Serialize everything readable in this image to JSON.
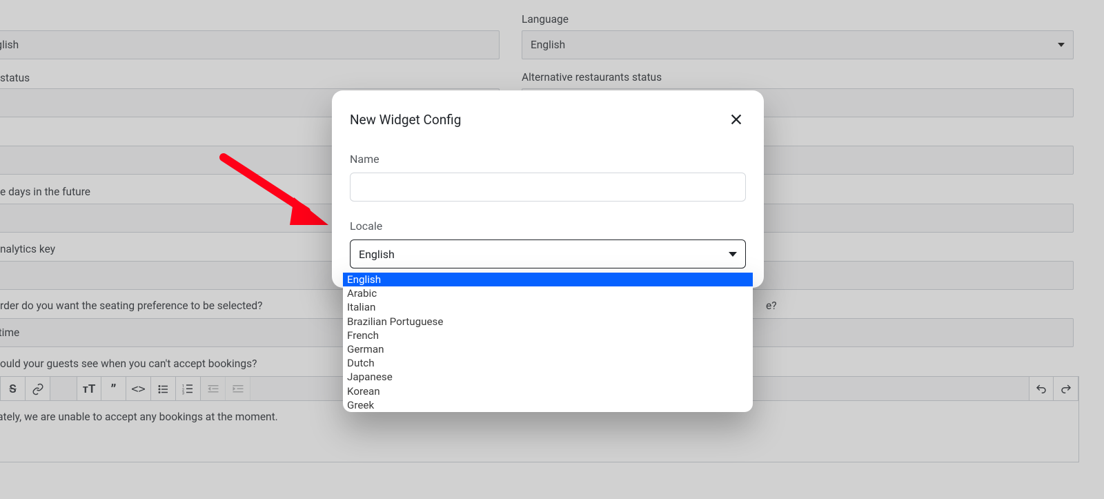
{
  "bg": {
    "left": {
      "english_value": "English",
      "status_label": "status",
      "days_future_label": "e days in the future",
      "analytics_label": "nalytics key",
      "seating_pref_label": "rder do you want the seating preference to be selected?",
      "seating_pref_value": "he time",
      "unavailable_msg_label": "ould your guests see when you can't accept bookings?",
      "unavailable_msg_value": "unately, we are unable to accept any bookings at the moment."
    },
    "right": {
      "language_label": "Language",
      "language_value": "English",
      "alt_status_label": "Alternative restaurants status",
      "seating_type_label_tail": "e?"
    }
  },
  "modal": {
    "title": "New Widget Config",
    "name_label": "Name",
    "name_value": "",
    "locale_label": "Locale",
    "locale_value": "English",
    "locale_options": [
      "English",
      "Arabic",
      "Italian",
      "Brazilian Portuguese",
      "French",
      "German",
      "Dutch",
      "Japanese",
      "Korean",
      "Greek"
    ],
    "locale_selected_index": 0
  },
  "annotation": {
    "arrow_color": "#ff0018"
  }
}
